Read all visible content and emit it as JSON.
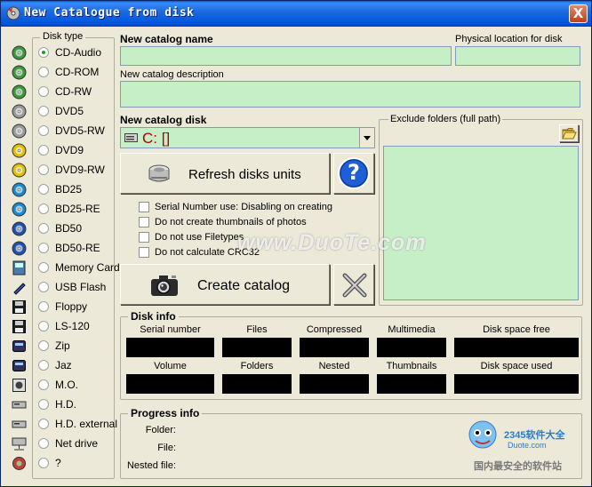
{
  "window": {
    "title": "New Catalogue from disk",
    "close_label": "X"
  },
  "disk_type": {
    "label": "Disk type",
    "selected": "CD-Audio",
    "items": [
      {
        "label": "CD-Audio",
        "icon": "cd-audio-icon",
        "checked": true
      },
      {
        "label": "CD-ROM",
        "icon": "cd-rom-icon"
      },
      {
        "label": "CD-RW",
        "icon": "cd-rw-icon"
      },
      {
        "label": "DVD5",
        "icon": "dvd5-icon"
      },
      {
        "label": "DVD5-RW",
        "icon": "dvd5-rw-icon"
      },
      {
        "label": "DVD9",
        "icon": "dvd9-icon"
      },
      {
        "label": "DVD9-RW",
        "icon": "dvd9-rw-icon"
      },
      {
        "label": "BD25",
        "icon": "bd25-icon"
      },
      {
        "label": "BD25-RE",
        "icon": "bd25-re-icon"
      },
      {
        "label": "BD50",
        "icon": "bd50-icon"
      },
      {
        "label": "BD50-RE",
        "icon": "bd50-re-icon"
      },
      {
        "label": "Memory Card",
        "icon": "memory-card-icon"
      },
      {
        "label": "USB Flash",
        "icon": "usb-flash-icon"
      },
      {
        "label": "Floppy",
        "icon": "floppy-icon"
      },
      {
        "label": "LS-120",
        "icon": "ls120-icon"
      },
      {
        "label": "Zip",
        "icon": "zip-drive-icon"
      },
      {
        "label": "Jaz",
        "icon": "jaz-drive-icon"
      },
      {
        "label": "M.O.",
        "icon": "mo-drive-icon"
      },
      {
        "label": "H.D.",
        "icon": "hard-disk-icon"
      },
      {
        "label": "H.D. external",
        "icon": "external-hard-disk-icon"
      },
      {
        "label": "Net drive",
        "icon": "net-drive-icon"
      },
      {
        "label": "?",
        "icon": "unknown-disk-icon"
      }
    ]
  },
  "form": {
    "catalog_name_label": "New catalog name",
    "catalog_name_value": "",
    "physical_location_label": "Physical location for disk",
    "physical_location_value": "",
    "description_label": "New catalog description",
    "description_value": "",
    "catalog_disk_label": "New catalog disk",
    "catalog_disk_value": "C: []",
    "exclude_folders_label": "Exclude folders (full path)"
  },
  "buttons": {
    "refresh": "Refresh disks units",
    "help": "?",
    "create": "Create catalog"
  },
  "options": [
    {
      "label": "Serial Number use: Disabling on creating",
      "checked": false
    },
    {
      "label": "Do not create thumbnails of photos",
      "checked": false
    },
    {
      "label": "Do not use Filetypes",
      "checked": false
    },
    {
      "label": "Do not calculate CRC32",
      "checked": false
    }
  ],
  "disk_info": {
    "label": "Disk info",
    "row1": [
      "Serial number",
      "Files",
      "Compressed",
      "Multimedia",
      "Disk space free"
    ],
    "row2": [
      "Volume",
      "Folders",
      "Nested",
      "Thumbnails",
      "Disk space used"
    ]
  },
  "progress_info": {
    "label": "Progress info",
    "folder_label": "Folder:",
    "file_label": "File:",
    "nested_file_label": "Nested file:"
  },
  "watermark": {
    "text": "www.DuoTe.com",
    "brand": "2345软件大全",
    "brand_sub": "Duote.com",
    "slogan": "国内最安全的软件站"
  },
  "colors": {
    "field_bg": "#c7efc7",
    "title_bar": "#0055dd",
    "window_bg": "#ece9d8"
  }
}
